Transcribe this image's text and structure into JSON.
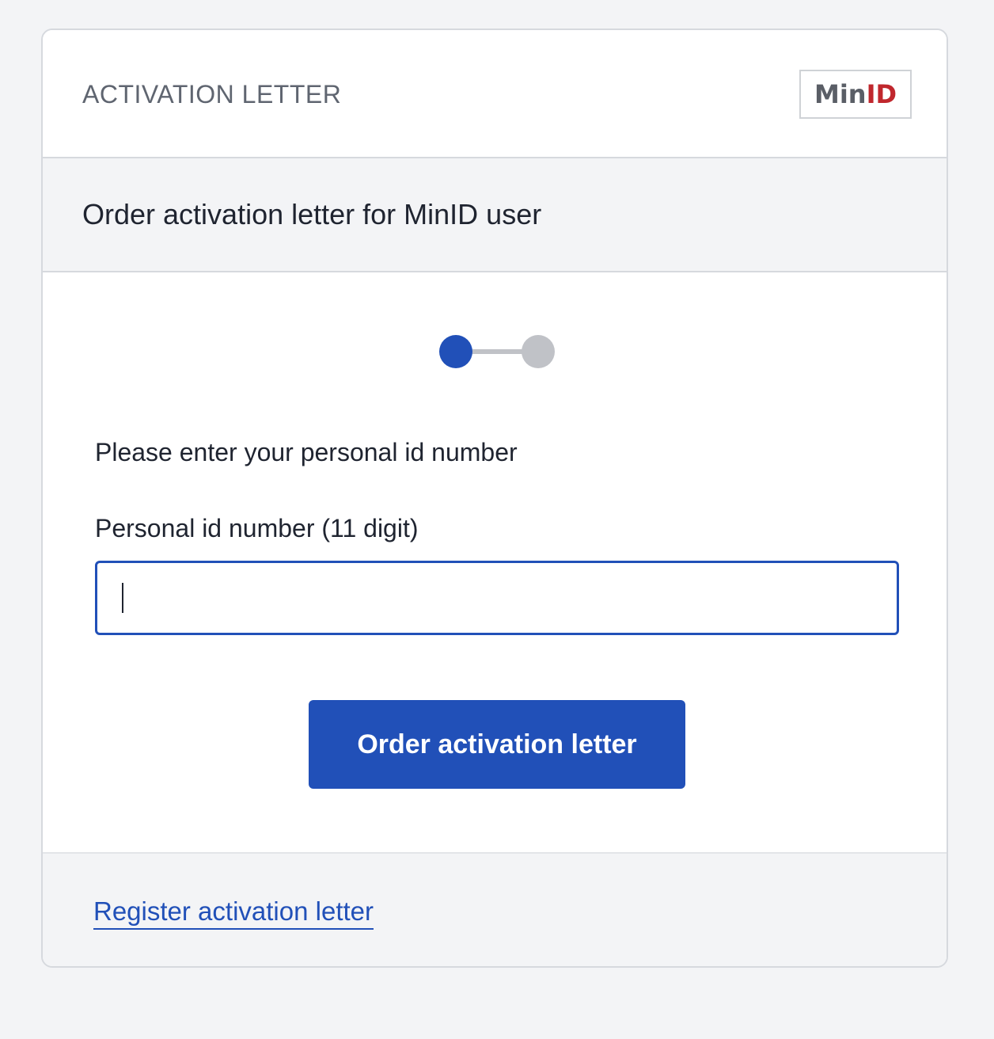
{
  "header": {
    "title": "ACTIVATION LETTER",
    "logo": {
      "text_min": "Min",
      "text_id": "ID",
      "colors": {
        "min": "#5a5e66",
        "id": "#c0272d"
      }
    }
  },
  "subheader": {
    "title": "Order activation letter for MinID user"
  },
  "stepper": {
    "current_step": 1,
    "total_steps": 2,
    "active_color": "#2150b8",
    "inactive_color": "#c0c2c7"
  },
  "form": {
    "instruction": "Please enter your personal id number",
    "field_label": "Personal id number (11 digit)",
    "field_value": "",
    "submit_label": "Order activation letter"
  },
  "footer": {
    "link_label": "Register activation letter"
  },
  "colors": {
    "accent": "#2150b8",
    "page_background": "#f3f4f6",
    "text": "#1f2430"
  }
}
